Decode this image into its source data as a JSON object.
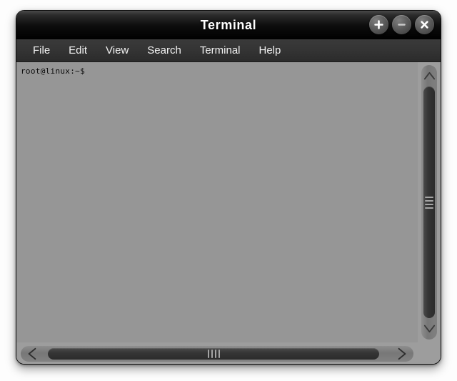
{
  "window": {
    "title": "Terminal",
    "controls": [
      {
        "name": "maximize-button",
        "icon": "plus-icon",
        "label": "+"
      },
      {
        "name": "minimize-button",
        "icon": "minus-icon",
        "label": "−"
      },
      {
        "name": "close-button",
        "icon": "close-icon",
        "label": "✕"
      }
    ]
  },
  "menubar": {
    "items": [
      {
        "label": "File"
      },
      {
        "label": "Edit"
      },
      {
        "label": "View"
      },
      {
        "label": "Search"
      },
      {
        "label": "Terminal"
      },
      {
        "label": "Help"
      }
    ]
  },
  "terminal": {
    "prompt": "root@linux:~$",
    "background_color": "#969696",
    "text_color": "#0a0a0a"
  },
  "scrollbars": {
    "vertical": {
      "up_arrow_icon": "chevron-up-icon",
      "down_arrow_icon": "chevron-down-icon",
      "grip_lines": 4
    },
    "horizontal": {
      "left_arrow_icon": "chevron-left-icon",
      "right_arrow_icon": "chevron-right-icon",
      "grip_lines": 4
    }
  },
  "colors": {
    "titlebar": "#000000",
    "menubar": "#333333",
    "window_border": "#0c0c0c",
    "scroll_track": "#7c7c7c",
    "scroll_thumb": "#343434"
  }
}
